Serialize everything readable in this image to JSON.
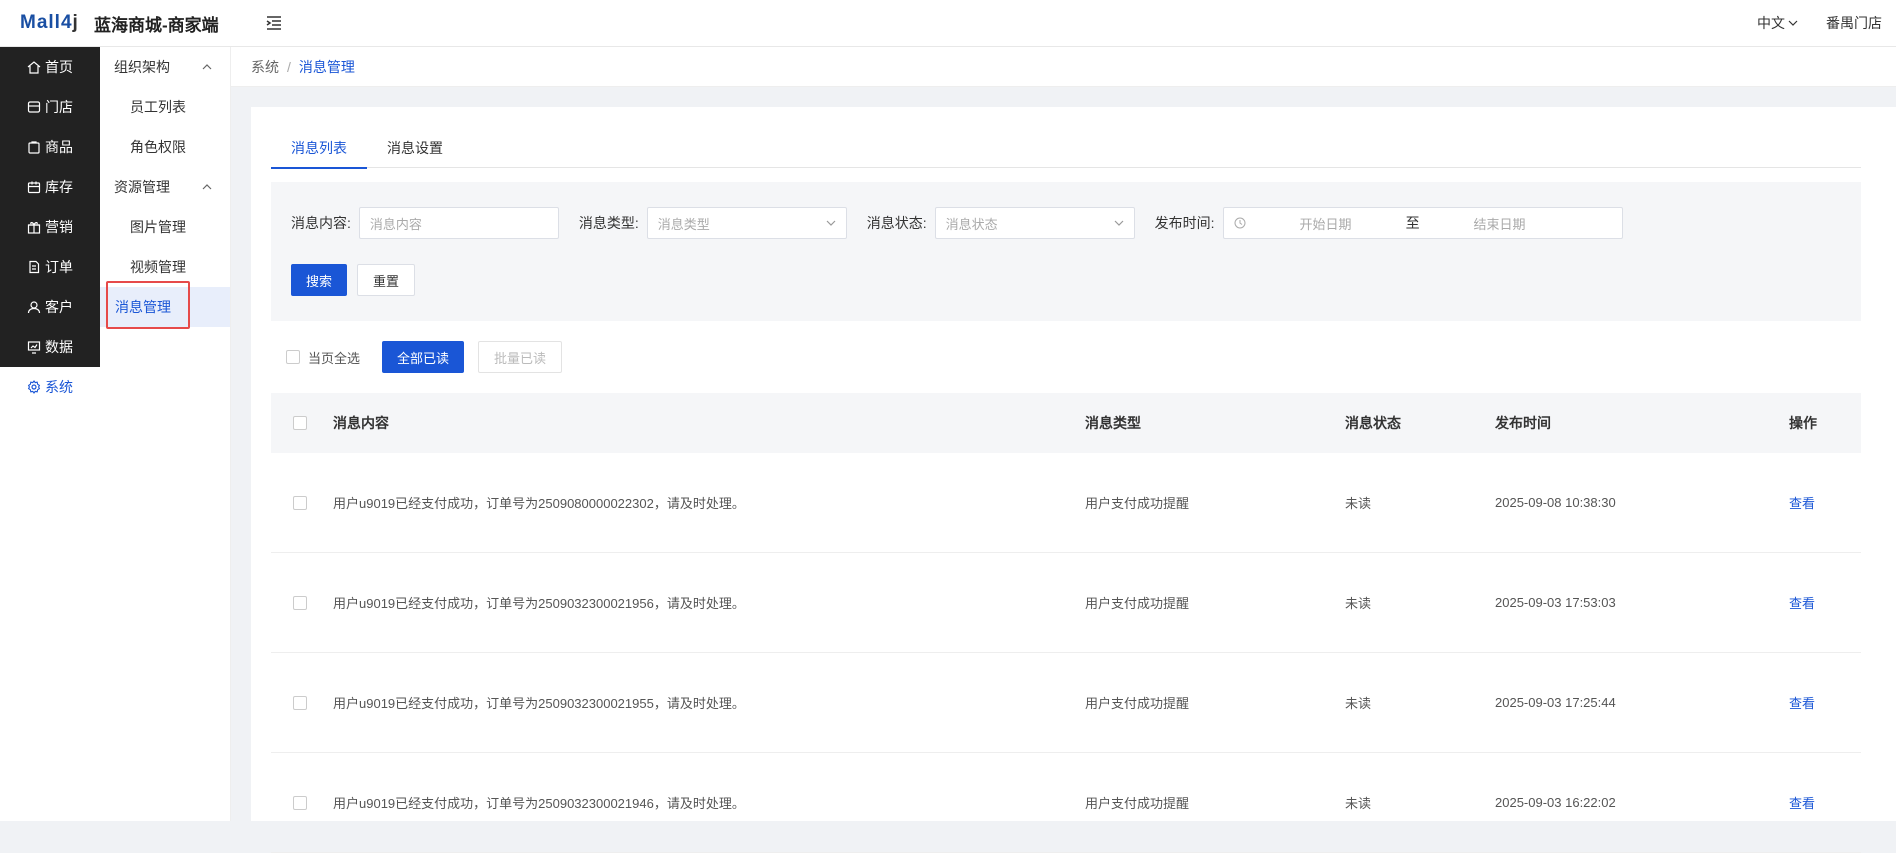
{
  "header": {
    "logo_main": "Mall4",
    "logo_j": "j",
    "store_name": "蓝海商城-商家端",
    "language": "中文",
    "shop": "番禺门店"
  },
  "sidebar_primary": [
    {
      "label": "首页",
      "icon": "home-icon"
    },
    {
      "label": "门店",
      "icon": "store-icon"
    },
    {
      "label": "商品",
      "icon": "goods-icon"
    },
    {
      "label": "库存",
      "icon": "inventory-icon"
    },
    {
      "label": "营销",
      "icon": "gift-icon"
    },
    {
      "label": "订单",
      "icon": "order-icon"
    },
    {
      "label": "客户",
      "icon": "customer-icon"
    },
    {
      "label": "数据",
      "icon": "data-icon"
    },
    {
      "label": "系统",
      "icon": "settings-icon",
      "active": true
    }
  ],
  "sidebar_secondary": {
    "group1": "组织架构",
    "group1_items": [
      "员工列表",
      "角色权限"
    ],
    "group2": "资源管理",
    "group2_items": [
      "图片管理",
      "视频管理",
      "消息管理"
    ]
  },
  "breadcrumb": {
    "root": "系统",
    "sep": "/",
    "current": "消息管理"
  },
  "tabs": [
    "消息列表",
    "消息设置"
  ],
  "filters": {
    "content_label": "消息内容:",
    "content_placeholder": "消息内容",
    "type_label": "消息类型:",
    "type_placeholder": "消息类型",
    "status_label": "消息状态:",
    "status_placeholder": "消息状态",
    "time_label": "发布时间:",
    "start_placeholder": "开始日期",
    "to": "至",
    "end_placeholder": "结束日期",
    "search": "搜索",
    "reset": "重置"
  },
  "actions": {
    "select_page": "当页全选",
    "mark_all_read": "全部已读",
    "batch_read": "批量已读"
  },
  "table": {
    "headers": [
      "消息内容",
      "消息类型",
      "消息状态",
      "发布时间",
      "操作"
    ],
    "rows": [
      {
        "content": "用户u9019已经支付成功，订单号为2509080000022302，请及时处理。",
        "type": "用户支付成功提醒",
        "status": "未读",
        "time": "2025-09-08 10:38:30",
        "action": "查看"
      },
      {
        "content": "用户u9019已经支付成功，订单号为2509032300021956，请及时处理。",
        "type": "用户支付成功提醒",
        "status": "未读",
        "time": "2025-09-03 17:53:03",
        "action": "查看"
      },
      {
        "content": "用户u9019已经支付成功，订单号为2509032300021955，请及时处理。",
        "type": "用户支付成功提醒",
        "status": "未读",
        "time": "2025-09-03 17:25:44",
        "action": "查看"
      },
      {
        "content": "用户u9019已经支付成功，订单号为2509032300021946，请及时处理。",
        "type": "用户支付成功提醒",
        "status": "未读",
        "time": "2025-09-03 16:22:02",
        "action": "查看"
      }
    ]
  }
}
